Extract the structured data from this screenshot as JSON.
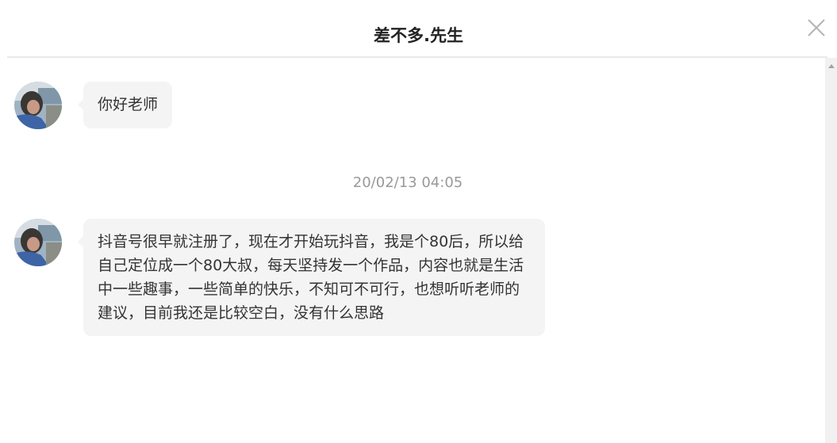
{
  "header": {
    "title": "差不多.先生"
  },
  "messages": [
    {
      "text": "你好老师"
    },
    {
      "timestamp": "20/02/13 04:05",
      "text": "抖音号很早就注册了，现在才开始玩抖音，我是个80后，所以给自己定位成一个80大叔，每天坚持发一个作品，内容也就是生活中一些趣事，一些简单的快乐，不知可不可行，也想听听老师的建议，目前我还是比较空白，没有什么思路"
    }
  ],
  "icons": {
    "close": "close-icon",
    "scroll_up": "scroll-up-arrow-icon"
  },
  "colors": {
    "bubble_bg": "#f4f4f5",
    "timestamp": "#999999",
    "divider": "#e9e9e9"
  }
}
